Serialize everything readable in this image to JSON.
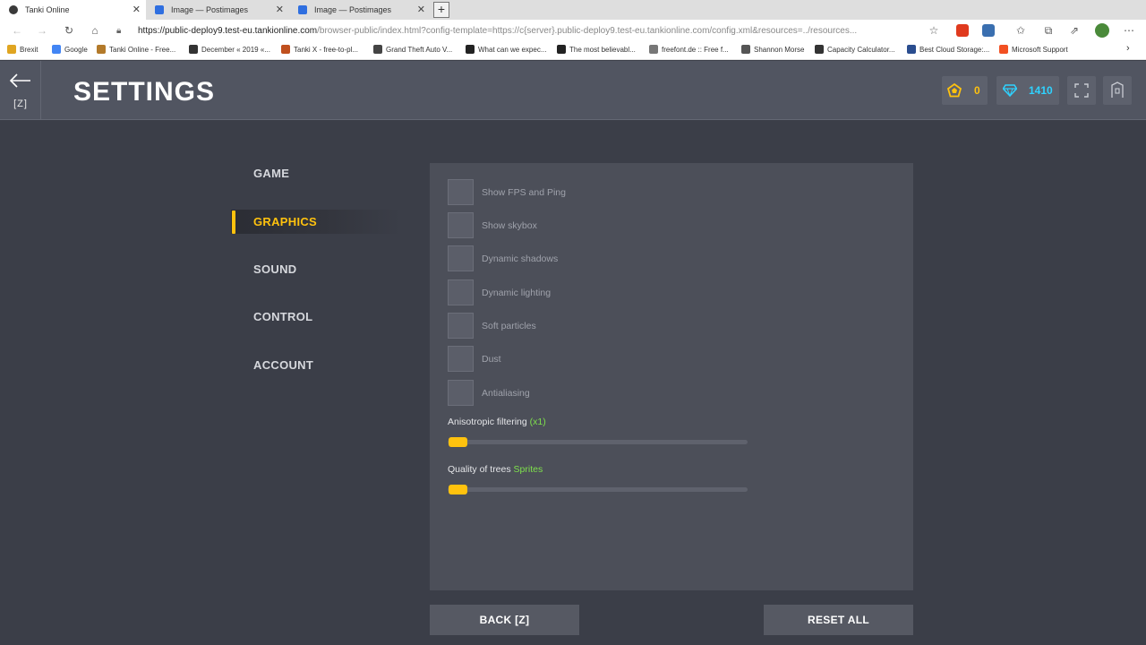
{
  "browser": {
    "tabs": [
      {
        "title": "Tanki Online"
      },
      {
        "title": "Image — Postimages"
      },
      {
        "title": "Image — Postimages"
      }
    ],
    "new_tab": "+",
    "url_main": "https://public-deploy9.test-eu.tankionline.com",
    "url_rest": "/browser-public/index.html?config-template=https://c{server}.public-deploy9.test-eu.tankionline.com/config.xml&resources=../resources...",
    "bookmarks": [
      {
        "label": "Brexit",
        "color": "#e0a521"
      },
      {
        "label": "Google",
        "color": "#4285f4"
      },
      {
        "label": "Tanki Online - Free...",
        "color": "#b37a2a"
      },
      {
        "label": "December « 2019 «...",
        "color": "#333333"
      },
      {
        "label": "Tanki X - free-to-pl...",
        "color": "#c0501e"
      },
      {
        "label": "Grand Theft Auto V...",
        "color": "#444444"
      },
      {
        "label": "What can we expec...",
        "color": "#222222"
      },
      {
        "label": "The most believabl...",
        "color": "#222222"
      },
      {
        "label": "freefont.de :: Free f...",
        "color": "#777777"
      },
      {
        "label": "Shannon Morse",
        "color": "#555555"
      },
      {
        "label": "Capacity Calculator...",
        "color": "#333333"
      },
      {
        "label": "Best Cloud Storage:...",
        "color": "#2a4d8f"
      },
      {
        "label": "Microsoft Support",
        "color": "#f25022"
      }
    ]
  },
  "header": {
    "back_key": "[Z]",
    "title": "SETTINGS",
    "crystals_gold": "0",
    "crystals_blue": "1410"
  },
  "menu": {
    "items": [
      "GAME",
      "GRAPHICS",
      "SOUND",
      "CONTROL",
      "ACCOUNT"
    ],
    "active": "GRAPHICS"
  },
  "graphics": {
    "options": [
      "Show FPS and Ping",
      "Show skybox",
      "Dynamic shadows",
      "Dynamic lighting",
      "Soft particles",
      "Dust",
      "Antialiasing"
    ],
    "aniso_label": "Anisotropic filtering",
    "aniso_value": "(x1)",
    "aniso_level": 0,
    "trees_label": "Quality of trees",
    "trees_value": "Sprites",
    "trees_level": 0
  },
  "footer": {
    "back_label": "BACK [Z]",
    "reset_label": "RESET ALL"
  },
  "colors": {
    "accent": "#ffc20e",
    "highlight": "#7ee04c",
    "crystal": "#2fd2ff"
  }
}
